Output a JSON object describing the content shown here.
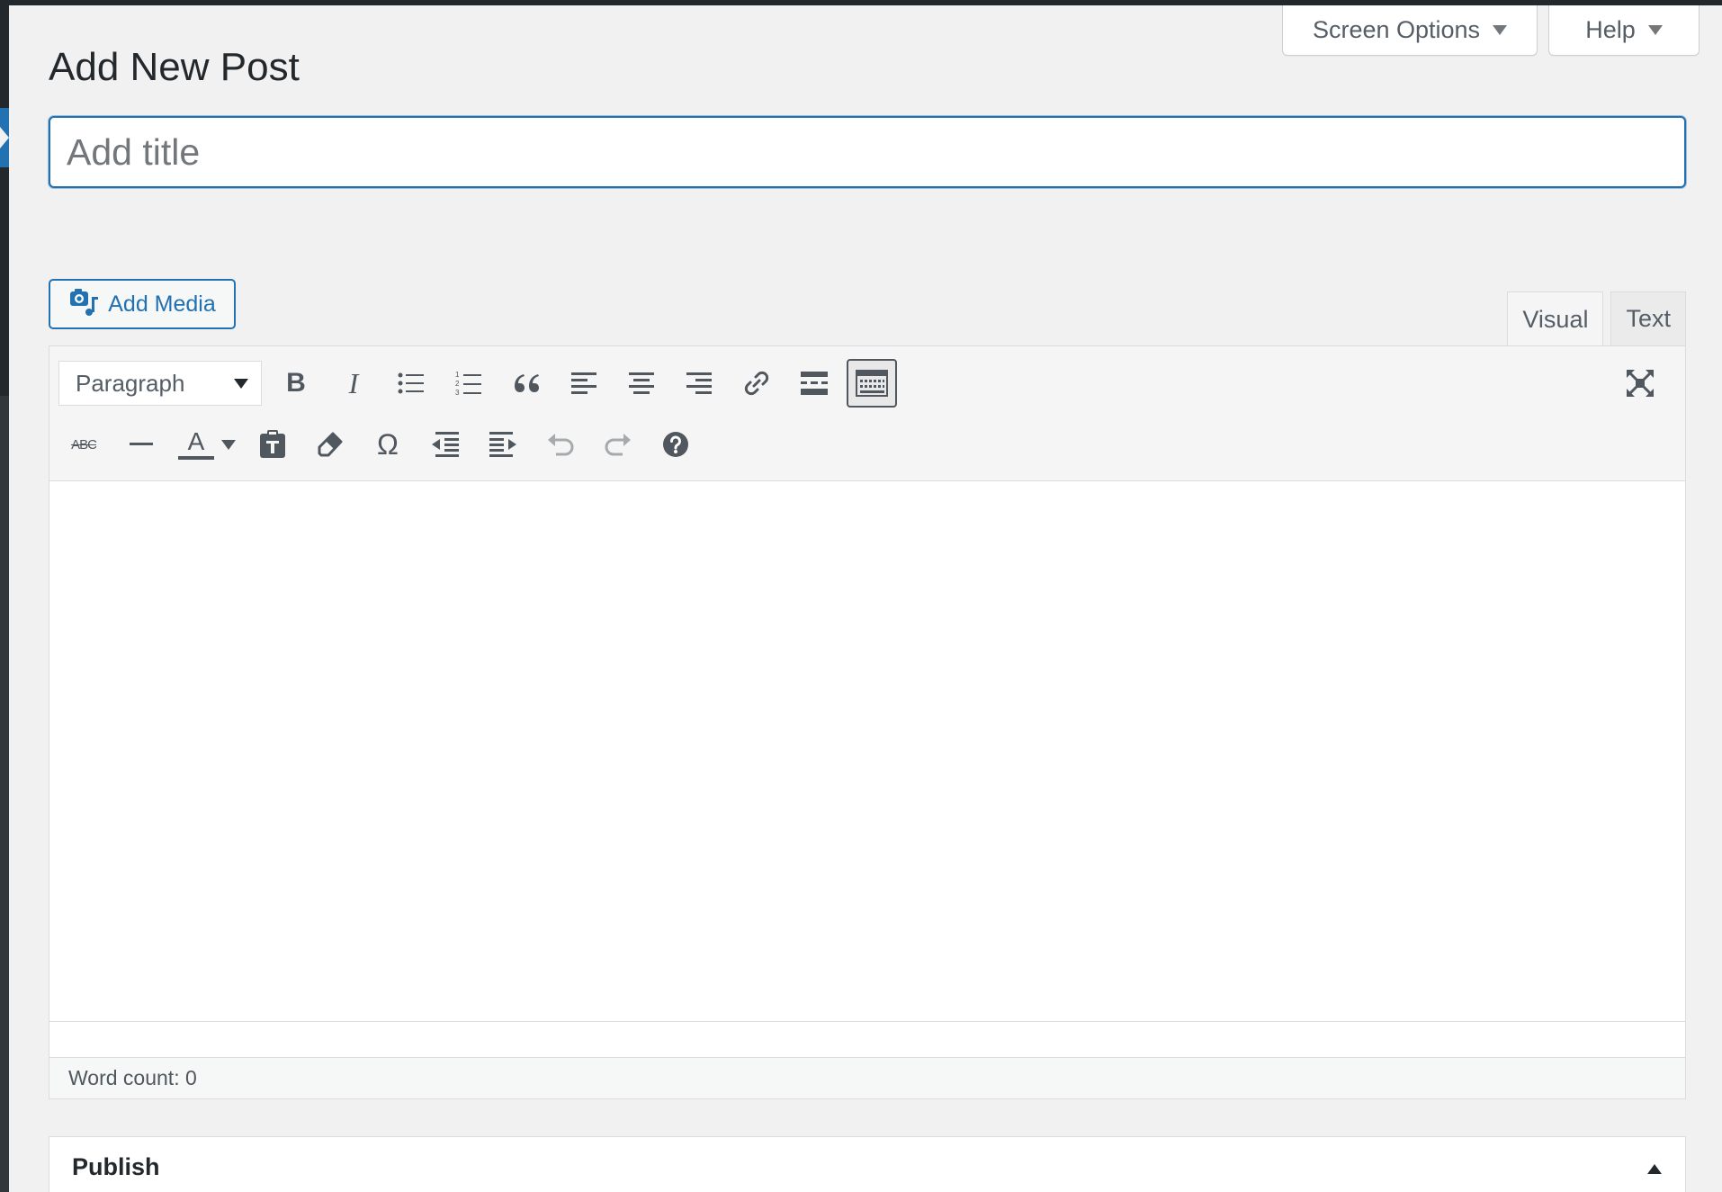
{
  "screen_meta": {
    "screen_options_label": "Screen Options",
    "help_label": "Help"
  },
  "page": {
    "title": "Add New Post"
  },
  "post_title": {
    "value": "",
    "placeholder": "Add title"
  },
  "media": {
    "add_media_label": "Add Media"
  },
  "editor_tabs": [
    {
      "label": "Visual",
      "active": true
    },
    {
      "label": "Text",
      "active": false
    }
  ],
  "toolbar": {
    "format_select_value": "Paragraph",
    "row1": [
      "bold-icon",
      "italic-icon",
      "bulleted-list-icon",
      "numbered-list-icon",
      "blockquote-icon",
      "align-left-icon",
      "align-center-icon",
      "align-right-icon",
      "link-icon",
      "read-more-icon",
      "toolbar-toggle-icon"
    ],
    "row2": [
      "strikethrough-icon",
      "horizontal-line-icon",
      "text-color-icon",
      "paste-as-text-icon",
      "clear-formatting-icon",
      "special-character-icon",
      "outdent-icon",
      "indent-icon",
      "undo-icon",
      "redo-icon",
      "help-icon"
    ],
    "fullscreen": "fullscreen-icon",
    "strikethrough_glyph": "ABC",
    "text_color_glyph": "A",
    "special_char_glyph": "Ω",
    "bold_glyph": "B",
    "italic_glyph": "I"
  },
  "editor_content": "",
  "status_bar": {
    "word_count_label": "Word count: 0"
  },
  "publish_box": {
    "title": "Publish"
  },
  "colors": {
    "accent": "#2271b1",
    "admin_bar": "#23282d",
    "background": "#f1f1f1"
  }
}
